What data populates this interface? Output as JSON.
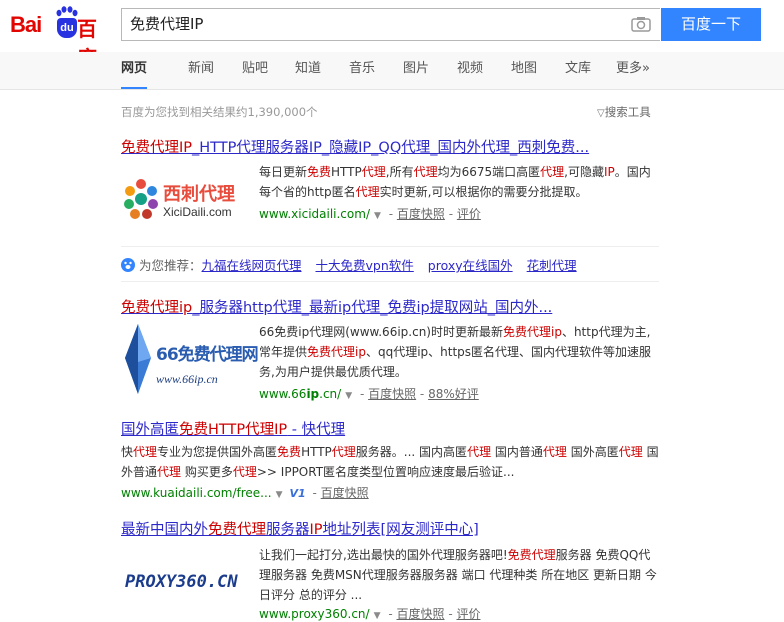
{
  "logo": {
    "bai": "Bai",
    "du": "du",
    "cn": "百度"
  },
  "search": {
    "query": "免费代理IP",
    "button": "百度一下"
  },
  "nav": {
    "items": [
      "网页",
      "新闻",
      "贴吧",
      "知道",
      "音乐",
      "图片",
      "视频",
      "地图",
      "文库",
      "更多»"
    ]
  },
  "info": {
    "count_text": "百度为您找到相关结果约1,390,000个",
    "tools": "搜索工具"
  },
  "results": [
    {
      "title_parts": [
        "免费代理IP",
        "_HTTP代理服务器IP_隐藏IP_QQ代理_国内外代理_西刺免费..."
      ],
      "desc_parts": [
        "每日更新",
        "免费",
        "HTTP",
        "代理",
        ",所有",
        "代理",
        "均为6675端口高匿",
        "代理",
        ",可隐藏",
        "IP",
        "。国内每个省的http匿名",
        "代理",
        "实时更新,可以根据你的需要分批提取。"
      ],
      "url": "www.xicidaili.com/",
      "links": [
        "百度快照",
        "评价"
      ],
      "thumb": {
        "brand": "西刺代理",
        "site": "XiciDaili.com"
      }
    },
    {
      "title_parts": [
        "免费代理ip",
        "_服务器http代理_最新ip代理_免费ip提取网站_国内外..."
      ],
      "desc_parts": [
        "66免费ip代理网(www.66ip.cn)时时更新最新",
        "免费代理ip",
        "、http代理为主,常年提供",
        "免费代理ip",
        "、qq代理ip、https匿名代理、国内代理软件等加速服务,为用户提供最优质代理。"
      ],
      "url_prefix": "www.66",
      "url_em": "ip",
      "url_suffix": ".cn/",
      "links": [
        "百度快照",
        "88%好评"
      ],
      "thumb": {
        "brand": "66免费代理网",
        "site": "www.66ip.cn"
      }
    },
    {
      "title_parts": [
        "国外高匿",
        "免费HTTP代理IP",
        " - 快代理"
      ],
      "desc_parts": [
        "快",
        "代理",
        "专业为您提供国外高匿",
        "免费",
        "HTTP",
        "代理",
        "服务器。... 国内高匿",
        "代理",
        " 国内普通",
        "代理",
        " 国外高匿",
        "代理",
        " 国外普通",
        "代理",
        " 购买更多",
        "代理",
        ">> IPPORT匿名度类型位置响应速度最后验证..."
      ],
      "url": "www.kuaidaili.com/free...",
      "v_badge": "V1",
      "links": [
        "百度快照"
      ]
    },
    {
      "title_parts": [
        "最新中国内外",
        "免费代理",
        "服务器",
        "IP",
        "地址列表[网友测评中心]"
      ],
      "desc_parts": [
        "让我们一起打分,选出最快的国外代理服务器吧!",
        "免费代理",
        "服务器 免费QQ代理服务器 免费MSN代理服务器服务器 端口 代理种类 所在地区 更新日期 今日评分 总的评分 ..."
      ],
      "url": "www.proxy360.cn/",
      "links": [
        "百度快照",
        "评价"
      ],
      "thumb": {
        "brand": "PROXY360.CN"
      }
    }
  ],
  "recommend": {
    "label": "为您推荐：",
    "items": [
      "九福在线网页代理",
      "十大免费vpn软件",
      "proxy在线国外",
      "花刺代理"
    ]
  }
}
